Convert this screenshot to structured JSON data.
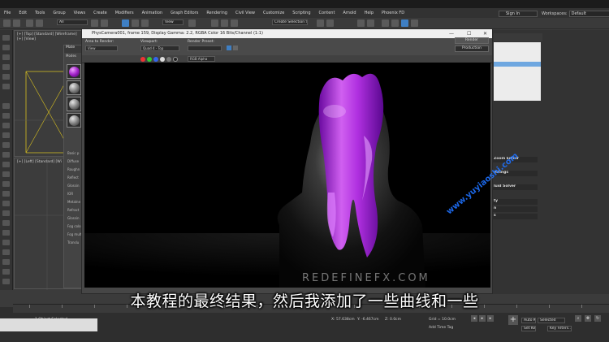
{
  "menubar": {
    "items": [
      "File",
      "Edit",
      "Tools",
      "Group",
      "Views",
      "Create",
      "Modifiers",
      "Animation",
      "Graph Editors",
      "Rendering",
      "Civil View",
      "Customize",
      "Scripting",
      "Content",
      "Arnold",
      "Help",
      "Phoenix FD"
    ],
    "sign_in": "Sign In",
    "workspaces_label": "Workspaces:",
    "workspaces_value": "Default"
  },
  "toolbar": {
    "selection_filter": "All",
    "view_mode": "View",
    "create_selection_set": "Create Selection Se"
  },
  "viewports": {
    "top_left_label": "[+] [Top] [Standard] [Wireframe]",
    "top_left_sub": "[+] [View]",
    "bottom_left_label": "[+] [Left] [Standard] [Wi"
  },
  "material_editor": {
    "title": "Mate",
    "menu": "Modes",
    "rows": [
      "Basic p",
      "Diffuse",
      "Roughn",
      "Reflect",
      "Glossin",
      "IOR",
      "Metalne",
      "Refract",
      "Glossin",
      "Fog colo",
      "Fog mult",
      "Translu"
    ]
  },
  "render_window": {
    "title": "PhysCamera001, frame 159, Display Gamma: 2.2, RGBA Color 16 Bits/Channel (1:1)",
    "area_label": "Area to Render:",
    "area_value": "View",
    "viewport_label": "Viewport:",
    "viewport_value": "Quad 4 - Top",
    "preset_label": "Render Preset:",
    "preset_value": "",
    "channel_value": "RGB Alpha",
    "render_button": "Render",
    "production_value": "Production",
    "minimize": "—",
    "maximize": "☐",
    "close": "✕"
  },
  "right_panel": {
    "rows": [
      "Zoom Editor",
      "ettings",
      "luid Solver",
      "",
      "ty",
      "n",
      "s"
    ]
  },
  "canvas": {
    "watermark_brand": "REDEFINEFX.COM",
    "watermark_site": "www.yuyiaoshi.com"
  },
  "subtitle": "本教程的最终结果，然后我添加了一些曲线和一些",
  "statusbar": {
    "objects_selected": "1 Object Selected",
    "coord_x": "X: 57.638cm",
    "coord_y": "Y: -6.467cm",
    "coord_z": "Z: 0.0cm",
    "grid": "Grid = 10.0cm",
    "add_time_tag": "Add Time Tag",
    "auto_key": "Auto Key",
    "set_key": "Set Key",
    "selected": "Selected",
    "key_filters": "Key Filters..."
  },
  "colors": {
    "accent_blue": "#3e7fc4",
    "fluid_purple": "#c040e0",
    "watermark_blue": "#1e72ff"
  }
}
